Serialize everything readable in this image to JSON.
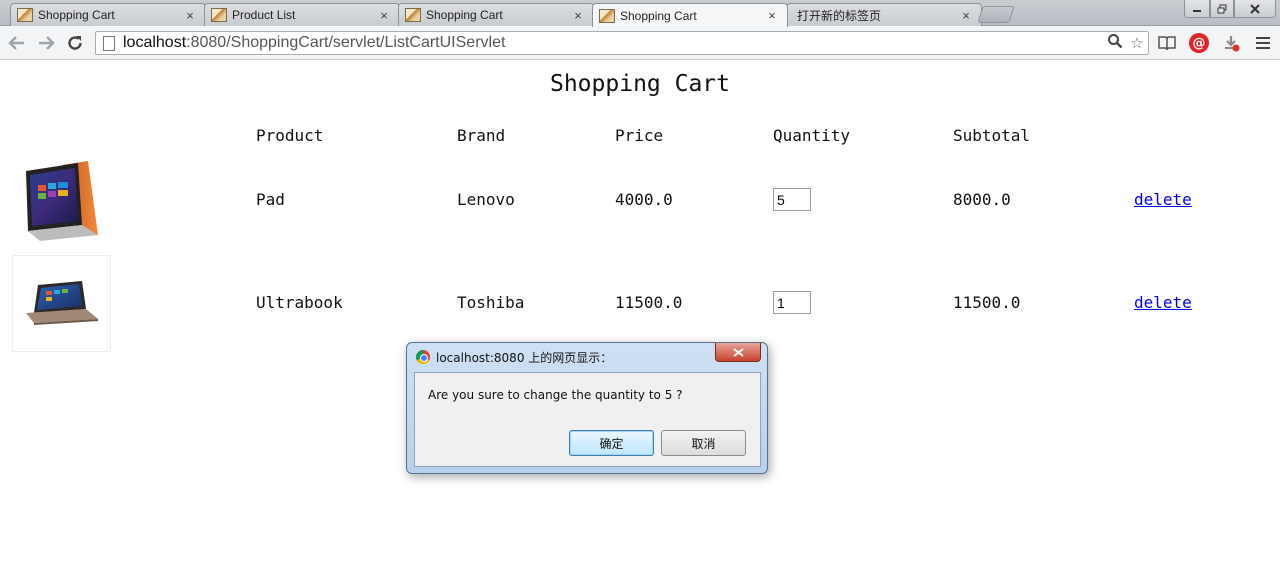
{
  "browser": {
    "tabs": [
      {
        "title": "Shopping Cart",
        "active": false
      },
      {
        "title": "Product List",
        "active": false
      },
      {
        "title": "Shopping Cart",
        "active": false
      },
      {
        "title": "Shopping Cart",
        "active": true
      },
      {
        "title": "打开新的标签页",
        "active": false
      }
    ],
    "tab_close_glyph": "×",
    "url_host": "localhost",
    "url_rest": ":8080/ShoppingCart/servlet/ListCartUIServlet"
  },
  "page": {
    "title": "Shopping Cart",
    "columns": {
      "product": "Product",
      "brand": "Brand",
      "price": "Price",
      "quantity": "Quantity",
      "subtotal": "Subtotal"
    },
    "rows": [
      {
        "product": "Pad",
        "brand": "Lenovo",
        "price": "4000.0",
        "quantity": "5",
        "subtotal": "8000.0",
        "action": "delete"
      },
      {
        "product": "Ultrabook",
        "brand": "Toshiba",
        "price": "11500.0",
        "quantity": "1",
        "subtotal": "11500.0",
        "action": "delete"
      }
    ]
  },
  "dialog": {
    "title": "localhost:8080 上的网页显示：",
    "message": "Are you sure to change the quantity to 5 ?",
    "ok_label": "确定",
    "cancel_label": "取消"
  },
  "colors": {
    "link": "#0000ee",
    "dialog_frame": "#b8d0ec",
    "close_button": "#c7432c"
  }
}
